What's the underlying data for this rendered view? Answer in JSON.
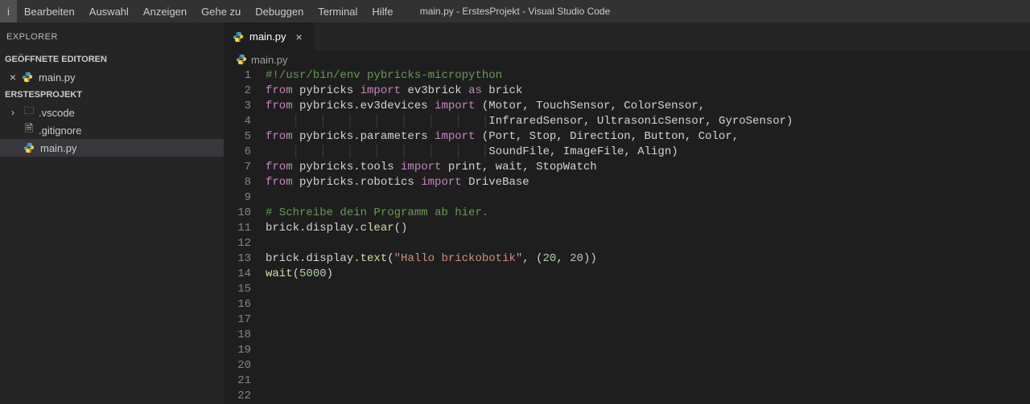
{
  "titlebar": {
    "menu": [
      "i",
      "Bearbeiten",
      "Auswahl",
      "Anzeigen",
      "Gehe zu",
      "Debuggen",
      "Terminal",
      "Hilfe"
    ],
    "title": "main.py - ErstesProjekt - Visual Studio Code"
  },
  "sidebar": {
    "title": "EXPLORER",
    "openEditorsLabel": "GEÖFFNETE EDITOREN",
    "openEditors": [
      {
        "name": "main.py"
      }
    ],
    "projectLabel": "ERSTESPROJEKT",
    "tree": [
      {
        "type": "folder",
        "name": ".vscode"
      },
      {
        "type": "file",
        "name": ".gitignore"
      },
      {
        "type": "file",
        "name": "main.py",
        "selected": true,
        "py": true
      }
    ]
  },
  "tabs": [
    {
      "name": "main.py",
      "active": true
    }
  ],
  "breadcrumb": {
    "file": "main.py"
  },
  "code": {
    "lines": [
      {
        "n": 1,
        "t": "comment",
        "text": "#!/usr/bin/env pybricks-micropython"
      },
      {
        "n": 2,
        "t": "import",
        "parts": [
          "from",
          " pybricks ",
          "import",
          " ev3brick ",
          "as",
          " brick"
        ]
      },
      {
        "n": 3,
        "t": "import",
        "parts": [
          "from",
          " pybricks.ev3devices ",
          "import",
          " (Motor, TouchSensor, ColorSensor,"
        ]
      },
      {
        "n": 4,
        "t": "cont",
        "indent": "                                 ",
        "text": "InfraredSensor, UltrasonicSensor, GyroSensor)"
      },
      {
        "n": 5,
        "t": "import",
        "parts": [
          "from",
          " pybricks.parameters ",
          "import",
          " (Port, Stop, Direction, Button, Color,"
        ]
      },
      {
        "n": 6,
        "t": "cont",
        "indent": "                                 ",
        "text": "SoundFile, ImageFile, Align)"
      },
      {
        "n": 7,
        "t": "import",
        "parts": [
          "from",
          " pybricks.tools ",
          "import",
          " print, wait, StopWatch"
        ]
      },
      {
        "n": 8,
        "t": "import",
        "parts": [
          "from",
          " pybricks.robotics ",
          "import",
          " DriveBase"
        ]
      },
      {
        "n": 9,
        "t": "blank"
      },
      {
        "n": 10,
        "t": "comment",
        "text": "# Schreibe dein Programm ab hier."
      },
      {
        "n": 11,
        "t": "call",
        "obj": "brick.display.",
        "fn": "clear",
        "args": "()"
      },
      {
        "n": 12,
        "t": "blank"
      },
      {
        "n": 13,
        "t": "call",
        "obj": "brick.display.",
        "fn": "text",
        "args_open": "(",
        "str": "\"Hallo brickobotik\"",
        "mid": ", (",
        "nums": [
          "20",
          ", ",
          "20"
        ],
        "args_close": "))"
      },
      {
        "n": 14,
        "t": "call",
        "obj": "",
        "fn": "wait",
        "args_open": "(",
        "nums": [
          "5000"
        ],
        "args_close": ")"
      },
      {
        "n": 15,
        "t": "blank"
      },
      {
        "n": 16,
        "t": "blank"
      },
      {
        "n": 17,
        "t": "blank"
      },
      {
        "n": 18,
        "t": "blank"
      },
      {
        "n": 19,
        "t": "blank"
      },
      {
        "n": 20,
        "t": "blank"
      },
      {
        "n": 21,
        "t": "blank"
      },
      {
        "n": 22,
        "t": "blank"
      }
    ]
  }
}
